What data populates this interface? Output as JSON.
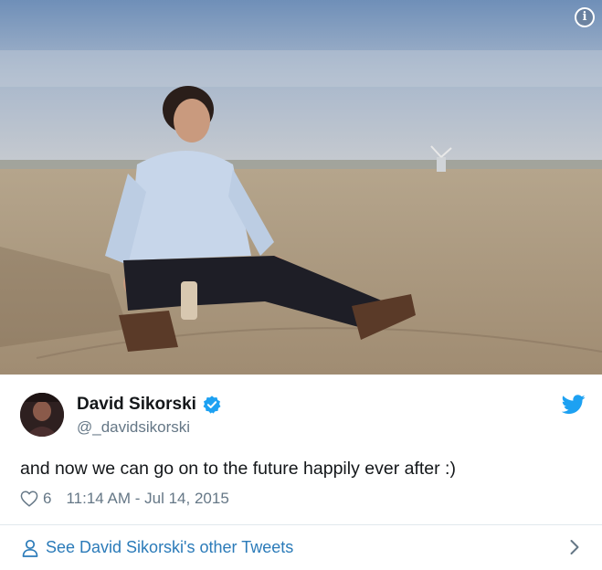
{
  "media": {
    "alt": "Photo",
    "info_icon": "info-icon"
  },
  "tweet": {
    "author": {
      "display_name": "David Sikorski",
      "handle": "@_davidsikorski",
      "verified": true,
      "avatar_icon": "avatar"
    },
    "text": "and now we can go on to the future happily ever after :)",
    "likes": "6",
    "timestamp": "11:14 AM - Jul 14, 2015",
    "platform_icon": "twitter-bird-icon"
  },
  "footer": {
    "link_label": "See David Sikorski's other Tweets",
    "person_icon": "person-icon",
    "chevron_icon": "chevron-right-icon"
  },
  "colors": {
    "link": "#2b7bb9",
    "muted": "#657786",
    "verified": "#1da1f2",
    "text": "#14171a",
    "divider": "#e1e8ed"
  }
}
